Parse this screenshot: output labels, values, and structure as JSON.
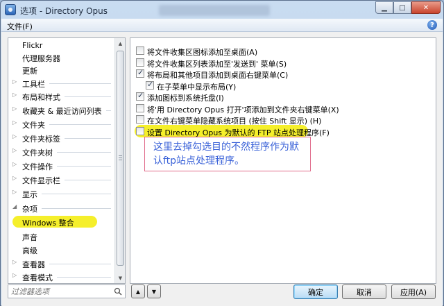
{
  "window": {
    "title": "选项 - Directory Opus"
  },
  "menu": {
    "file": "文件(F)"
  },
  "tree": {
    "items": [
      {
        "label": "Flickr",
        "type": "child"
      },
      {
        "label": "代理服务器",
        "type": "child"
      },
      {
        "label": "更新",
        "type": "child"
      },
      {
        "label": "工具栏",
        "type": "group",
        "state": "collapsed"
      },
      {
        "label": "布局和样式",
        "type": "group",
        "state": "collapsed"
      },
      {
        "label": "收藏夹 & 最近访问列表",
        "type": "group",
        "state": "collapsed"
      },
      {
        "label": "文件夹",
        "type": "group",
        "state": "collapsed"
      },
      {
        "label": "文件夹标签",
        "type": "group",
        "state": "collapsed"
      },
      {
        "label": "文件夹树",
        "type": "group",
        "state": "collapsed"
      },
      {
        "label": "文件操作",
        "type": "group",
        "state": "collapsed"
      },
      {
        "label": "文件显示栏",
        "type": "group",
        "state": "collapsed"
      },
      {
        "label": "显示",
        "type": "group",
        "state": "collapsed"
      },
      {
        "label": "杂项",
        "type": "group",
        "state": "expanded"
      },
      {
        "label": "Windows 整合",
        "type": "selected"
      },
      {
        "label": "声音",
        "type": "child"
      },
      {
        "label": "高级",
        "type": "child"
      },
      {
        "label": "查看器",
        "type": "group",
        "state": "collapsed"
      },
      {
        "label": "查看模式",
        "type": "group",
        "state": "collapsed"
      }
    ]
  },
  "filter": {
    "placeholder": "过滤器选项"
  },
  "options": [
    {
      "label": "将文件收集区图标添加至桌面(A)",
      "checked": false,
      "indent": false
    },
    {
      "label": "将文件收集区列表添加至'发送到' 菜单(S)",
      "checked": false,
      "indent": false
    },
    {
      "label": "将布局和其他项目添加到桌面右键菜单(C)",
      "checked": true,
      "indent": false
    },
    {
      "label": "在子菜单中显示布局(Y)",
      "checked": true,
      "indent": true
    },
    {
      "label": "添加图标到系统托盘(I)",
      "checked": true,
      "indent": false
    },
    {
      "label": "将'用 Directory Opus 打开'项添加到文件夹右键菜单(X)",
      "checked": false,
      "indent": false
    },
    {
      "label": "在文件右键菜单隐藏系统项目 (按住 Shift 显示) (H)",
      "checked": false,
      "indent": false
    },
    {
      "label": "设置 Directory Opus 为默认的 FTP 站点处理程序(F)",
      "checked": false,
      "indent": false,
      "highlighted": true
    }
  ],
  "note": {
    "line1": "这里去掉勾选目的不然程序作为默",
    "line2": "认ftp站点处理程序。"
  },
  "buttons": {
    "ok": "确定",
    "cancel": "取消",
    "apply": "应用(A)"
  },
  "colors": {
    "highlight": "#f5ef2b",
    "note_border": "#e06a8a",
    "note_text": "#3a62d8"
  }
}
